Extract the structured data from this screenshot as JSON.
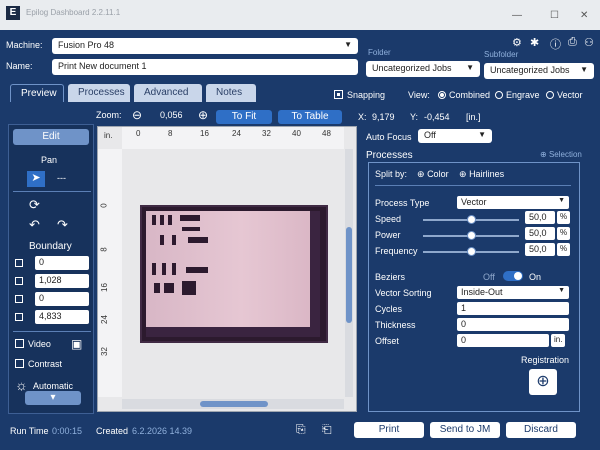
{
  "window": {
    "title": "Epilog Dashboard 2.2.11.1"
  },
  "header": {
    "machine_label": "Machine:",
    "machine_value": "Fusion Pro 48",
    "name_label": "Name:",
    "name_value": "Print New document 1",
    "folder_label": "Folder",
    "folder_value": "Uncategorized Jobs",
    "subfolder_label": "Subfolder",
    "subfolder_value": "Uncategorized Jobs"
  },
  "tabs": [
    "Preview",
    "Processes",
    "Advanced",
    "Notes"
  ],
  "view_options": {
    "snapping_label": "Snapping",
    "view_label": "View:",
    "combined": "Combined",
    "engrave": "Engrave",
    "vector": "Vector"
  },
  "zoom": {
    "label": "Zoom:",
    "value": "0,056",
    "to_fit": "To Fit",
    "to_table": "To Table"
  },
  "coords": {
    "x_label": "X:",
    "x_value": "9,179",
    "y_label": "Y:",
    "y_value": "-0,454",
    "units": "[in.]"
  },
  "ruler": {
    "unit": "in.",
    "top_ticks": [
      "0",
      "8",
      "16",
      "24",
      "32",
      "40",
      "48"
    ],
    "left_ticks": [
      "0",
      "8",
      "16",
      "24",
      "32"
    ]
  },
  "left_panel": {
    "edit": "Edit",
    "pan": "Pan",
    "pointer_value": "---",
    "boundary_label": "Boundary",
    "boundary_values": [
      "0",
      "1,028",
      "0",
      "4,833"
    ],
    "video_label": "Video",
    "contrast_label": "Contrast",
    "automatic_label": "Automatic"
  },
  "right_panel": {
    "auto_focus_label": "Auto Focus",
    "auto_focus_value": "Off",
    "processes_title": "Processes",
    "selection_label": "Selection",
    "split_by_label": "Split by:",
    "split_color": "Color",
    "split_hairlines": "Hairlines",
    "process_type_label": "Process Type",
    "process_type_value": "Vector",
    "speed_label": "Speed",
    "speed_value": "50,0",
    "power_label": "Power",
    "power_value": "50,0",
    "frequency_label": "Frequency",
    "frequency_value": "50,0",
    "percent": "%",
    "beziers_label": "Beziers",
    "beziers_off": "Off",
    "beziers_on": "On",
    "vector_sorting_label": "Vector Sorting",
    "vector_sorting_value": "Inside-Out",
    "cycles_label": "Cycles",
    "cycles_value": "1",
    "thickness_label": "Thickness",
    "thickness_value": "0",
    "offset_label": "Offset",
    "offset_value": "0",
    "offset_unit": "in.",
    "registration_label": "Registration"
  },
  "footer": {
    "run_time_label": "Run Time",
    "run_time_value": "0:00:15",
    "created_label": "Created",
    "created_value": "6.2.2026 14.39",
    "print": "Print",
    "send_to_jm": "Send to JM",
    "discard": "Discard"
  },
  "colors": {
    "panel_bg": "#1b3a6b",
    "accent": "#2f6fc6",
    "design_dark": "#2c1a2e",
    "design_light": "#e2c2cf"
  }
}
